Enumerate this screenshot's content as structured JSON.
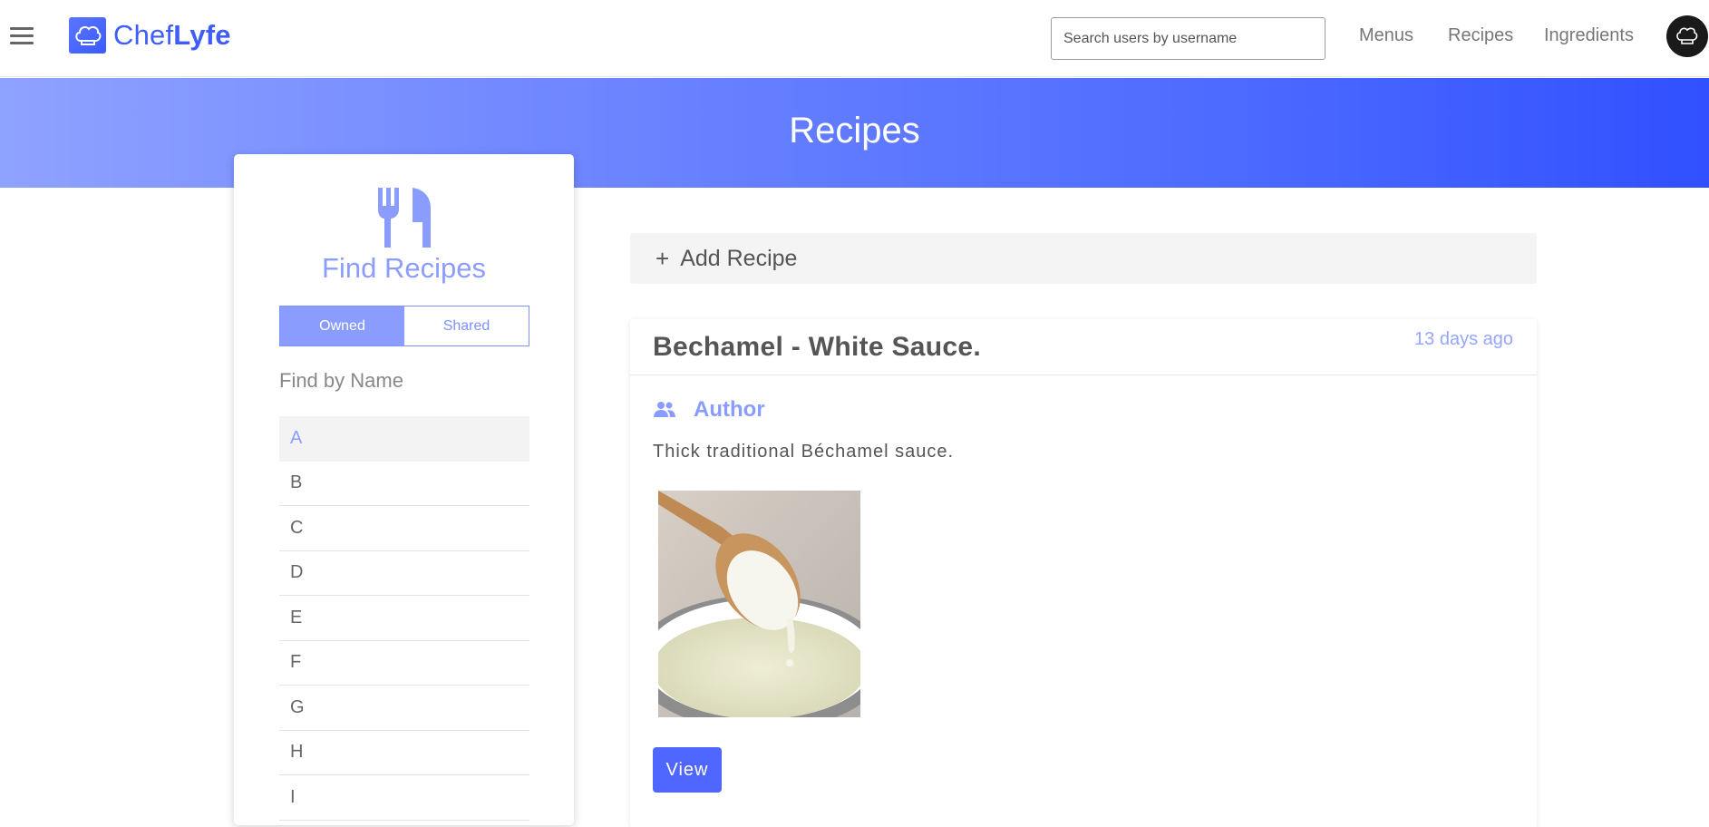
{
  "header": {
    "logo_text_light": "Chef",
    "logo_text_bold": "Lyfe",
    "search_placeholder": "Search users by username",
    "nav": [
      "Menus",
      "Recipes",
      "Ingredients"
    ]
  },
  "band": {
    "title": "Recipes"
  },
  "sidebar": {
    "title": "Find Recipes",
    "toggle": {
      "owned": "Owned",
      "shared": "Shared",
      "selected": "Owned"
    },
    "find_by_name": "Find by Name",
    "letters": [
      "A",
      "B",
      "C",
      "D",
      "E",
      "F",
      "G",
      "H",
      "I"
    ],
    "selected_letter": "A"
  },
  "main": {
    "add_recipe_label": "Add Recipe",
    "recipe": {
      "title": "Bechamel - White Sauce.",
      "date": "13 days ago",
      "author_label": "Author",
      "description": "Thick traditional Béchamel sauce.",
      "view_label": "View"
    }
  },
  "colors": {
    "brand": "#3f5cff",
    "accent_light": "#8c9dff",
    "button": "#4f67ff"
  },
  "icons": {
    "menu": "hamburger-icon",
    "logo": "chef-hat-icon",
    "sidebar": "fork-knife-icon",
    "author": "people-icon",
    "add": "plus-icon"
  }
}
